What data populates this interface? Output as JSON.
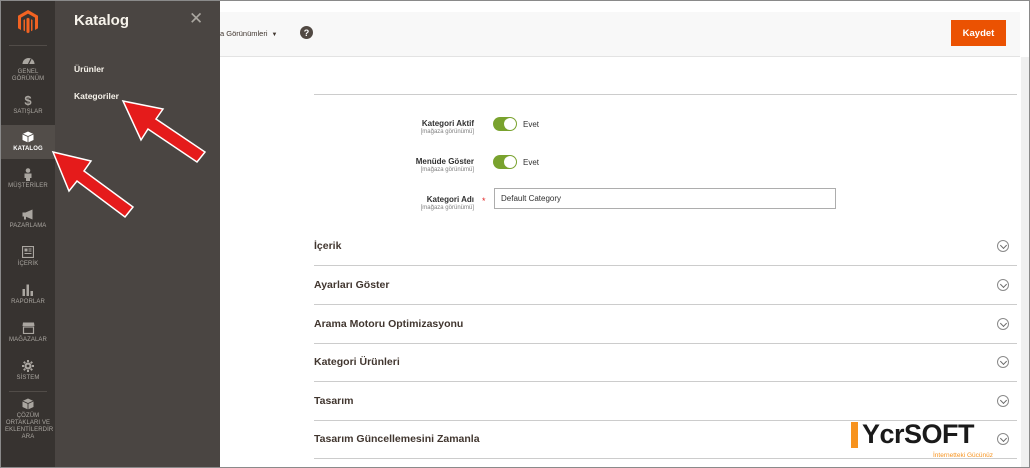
{
  "nav": {
    "items": [
      {
        "label": "GENEL GÖRÜNÜM",
        "icon": "dashboard-icon"
      },
      {
        "label": "SATIŞLAR",
        "icon": "dollar-icon"
      },
      {
        "label": "KATALOG",
        "icon": "catalog-box-icon"
      },
      {
        "label": "MÜŞTERİLER",
        "icon": "customer-icon"
      },
      {
        "label": "PAZARLAMA",
        "icon": "megaphone-icon"
      },
      {
        "label": "İÇERİK",
        "icon": "content-icon"
      },
      {
        "label": "RAPORLAR",
        "icon": "bar-chart-icon"
      },
      {
        "label": "MAĞAZALAR",
        "icon": "store-icon"
      },
      {
        "label": "SİSTEM",
        "icon": "gear-icon"
      },
      {
        "label": "ÇÖZÜM ORTAKLARI VE EKLENTİLERDİR ARA",
        "icon": "extensions-box-icon"
      }
    ]
  },
  "flyout": {
    "title": "Katalog",
    "close": "✕",
    "links": [
      "Ürünler",
      "Kategoriler"
    ]
  },
  "header": {
    "scope_label": "a Görünümleri",
    "help": "?",
    "save": "Kaydet"
  },
  "form": {
    "active": {
      "label": "Kategori Aktif",
      "scope": "[mağaza görünümü]",
      "value": "Evet"
    },
    "menu": {
      "label": "Menüde Göster",
      "scope": "[mağaza görünümü]",
      "value": "Evet"
    },
    "name": {
      "label": "Kategori Adı",
      "scope": "[mağaza görünümü]",
      "value": "Default Category",
      "required": "*"
    }
  },
  "sections": [
    "İçerik",
    "Ayarları Göster",
    "Arama Motoru Optimizasyonu",
    "Kategori Ürünleri",
    "Tasarım",
    "Tasarım Güncellemesini Zamanla"
  ],
  "watermark": {
    "brand": "YcrSOFT",
    "slogan": "İnternetteki Gücünüz"
  },
  "colors": {
    "nav_bg": "#373330",
    "flyout_bg": "#4a4542",
    "accent": "#eb5202",
    "toggle_on": "#79a22e",
    "arrow": "#e51b1b"
  }
}
